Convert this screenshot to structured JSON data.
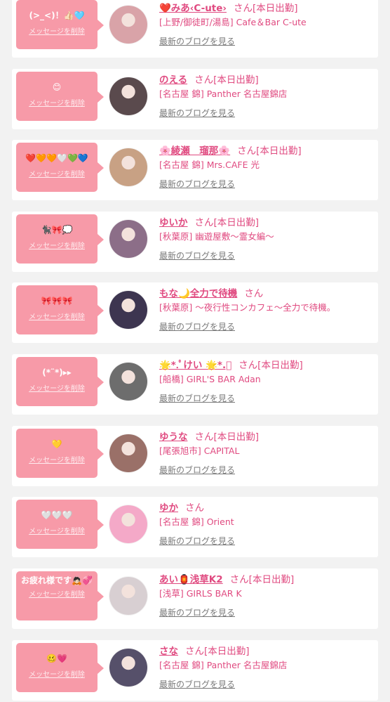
{
  "items": [
    {
      "message": "(>_<)！👍🏻🩵",
      "delete_label": "メッセージを削除",
      "name": "❤️みあ‹C-ute›",
      "honorific": "さん",
      "status": "[本日出勤]",
      "shop": "[上野/御徒町/湯島] Cafe＆Bar C-ute",
      "blog_link": "最新のブログを見る",
      "avatar_color": "#d9a3a8"
    },
    {
      "message": "😊",
      "delete_label": "メッセージを削除",
      "name": "のえる",
      "honorific": "さん",
      "status": "[本日出勤]",
      "shop": "[名古屋 錦] Panther 名古屋錦店",
      "blog_link": "最新のブログを見る",
      "avatar_color": "#5a4a4d"
    },
    {
      "message": "❤️🧡🧡🤍💚💙",
      "delete_label": "メッセージを削除",
      "name": "🌸綾瀬　瑠那🌸",
      "honorific": "さん",
      "status": "[本日出勤]",
      "shop": "[名古屋 錦] Mrs.CAFE 光",
      "blog_link": "最新のブログを見る",
      "avatar_color": "#c8a184"
    },
    {
      "message": "🐈‍⬛🎀💭",
      "delete_label": "メッセージを削除",
      "name": "ゆいか",
      "honorific": "さん",
      "status": "[本日出勤]",
      "shop": "[秋葉原] 幽遊屋敷〜霊女編〜",
      "blog_link": "最新のブログを見る",
      "avatar_color": "#8c6e88"
    },
    {
      "message": "🎀🎀🎀",
      "delete_label": "メッセージを削除",
      "name": "もな🌙全力で待機",
      "honorific": "さん",
      "status": "",
      "shop": "[秋葉原] 〜夜行性コンカフェ〜全力で待機。",
      "blog_link": "最新のブログを見る",
      "avatar_color": "#3d3550"
    },
    {
      "message": "(*¨︎*)▸▸",
      "delete_label": "メッセージを削除",
      "name": "🌟*.ﾟけい 🌟*.ﾟ",
      "honorific": "さん",
      "status": "[本日出勤]",
      "shop": "[船橋] GIRL'S BAR Adan",
      "blog_link": "最新のブログを見る",
      "avatar_color": "#6d6d6d"
    },
    {
      "message": "💛",
      "delete_label": "メッセージを削除",
      "name": "ゆうな",
      "honorific": "さん",
      "status": "[本日出勤]",
      "shop": "[尾張旭市] CAPITAL",
      "blog_link": "最新のブログを見る",
      "avatar_color": "#9a7068"
    },
    {
      "message": "🤍🤍🤍",
      "delete_label": "メッセージを削除",
      "name": "ゆか",
      "honorific": "さん",
      "status": "",
      "shop": "[名古屋 錦] Orient",
      "blog_link": "最新のブログを見る",
      "avatar_color": "#f4a9c8"
    },
    {
      "message": "お疲れ様です🙇🏻💞",
      "delete_label": "メッセージを削除",
      "name": "あい🏮浅草K2",
      "honorific": "さん",
      "status": "[本日出勤]",
      "shop": "[浅草] GIRLS BAR K",
      "blog_link": "最新のブログを見る",
      "avatar_color": "#d8cfd2"
    },
    {
      "message": "🥴💗",
      "delete_label": "メッセージを削除",
      "name": "さな",
      "honorific": "さん",
      "status": "[本日出勤]",
      "shop": "[名古屋 錦] Panther 名古屋錦店",
      "blog_link": "最新のブログを見る",
      "avatar_color": "#56506a"
    }
  ]
}
